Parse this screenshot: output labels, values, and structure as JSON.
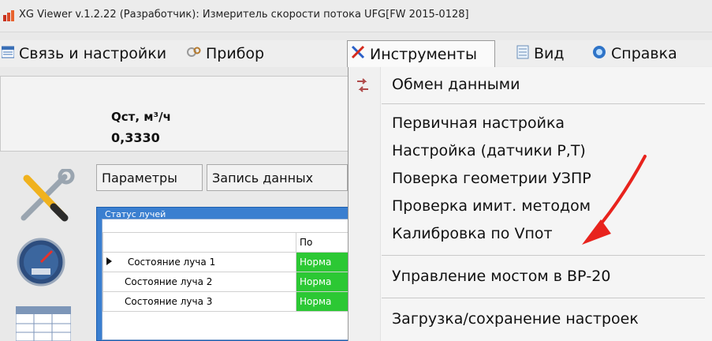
{
  "window": {
    "title": "XG Viewer v.1.2.22 (Разработчик): Измеритель скорости потока UFG[FW 2015-0128]"
  },
  "menubar": {
    "items": [
      {
        "label": "Связь и настройки",
        "icon": "connection-settings-icon"
      },
      {
        "label": "Прибор",
        "icon": "device-icon"
      },
      {
        "label": "Инструменты",
        "icon": "tools-icon"
      },
      {
        "label": "Вид",
        "icon": "view-icon"
      },
      {
        "label": "Справка",
        "icon": "help-icon"
      }
    ]
  },
  "header": {
    "q_label": "Qст, м³/ч",
    "q_value": "0,3330"
  },
  "buttons": {
    "params": "Параметры",
    "record": "Запись данных"
  },
  "rays": {
    "legend": "Статус лучей",
    "column_header": "По",
    "rows": [
      {
        "name": "Состояние луча 1",
        "status": "Норма"
      },
      {
        "name": "Состояние луча 2",
        "status": "Норма"
      },
      {
        "name": "Состояние луча 3",
        "status": "Норма"
      }
    ],
    "status_color": "#2cc834"
  },
  "tools_menu": {
    "items": [
      "Обмен данными",
      "Первичная настройка",
      "Настройка (датчики Р,Т)",
      "Поверка геометрии УЗПР",
      "Проверка имит. методом",
      "Калибровка по Vпот",
      "Управление мостом в ВР-20",
      "Загрузка/сохранение настроек"
    ]
  },
  "colors": {
    "annotation_arrow": "#e8231d",
    "panel_blue": "#3a7fd0"
  }
}
